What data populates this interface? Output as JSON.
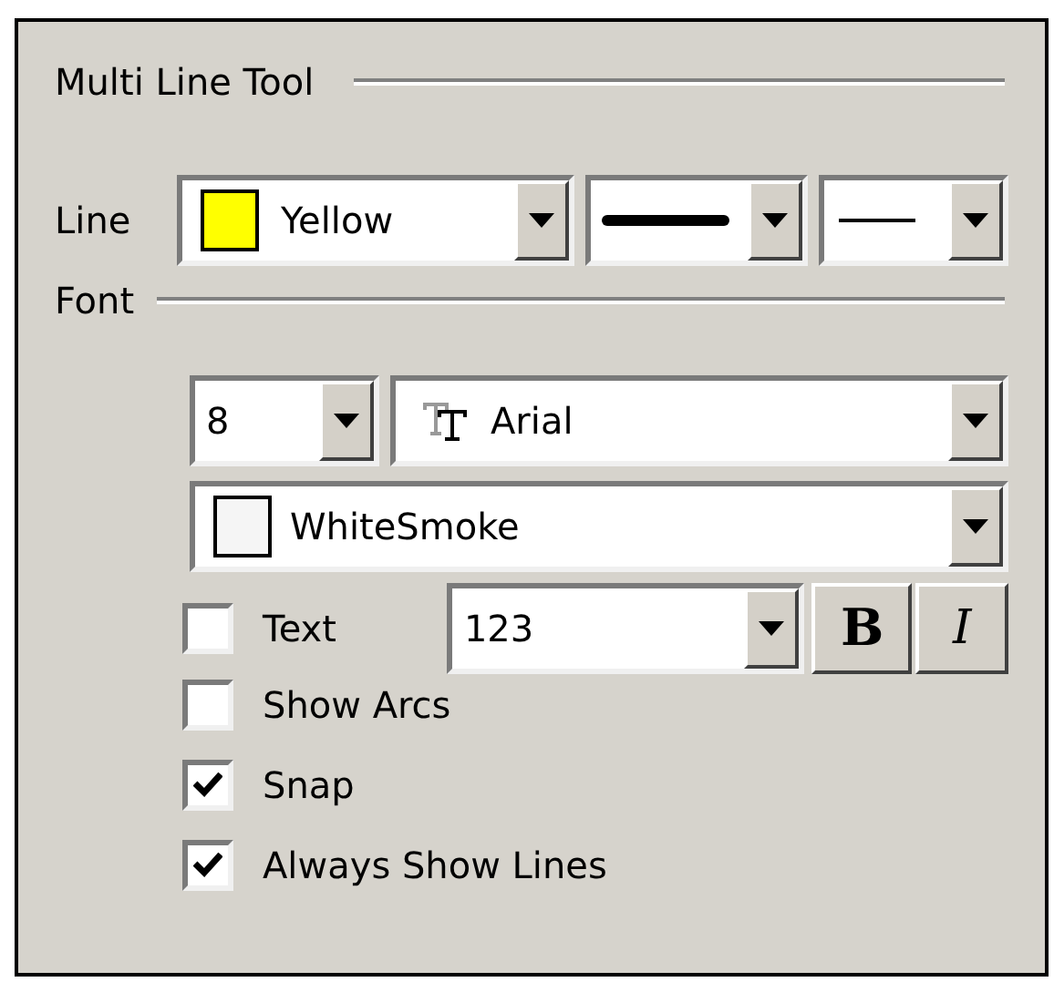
{
  "title": "Multi Line Tool",
  "line": {
    "label": "Line",
    "color": {
      "name": "Yellow",
      "color": "#ffff00"
    }
  },
  "font": {
    "label": "Font",
    "size": "8",
    "family": "Arial",
    "color": {
      "name": "WhiteSmoke",
      "color": "#f5f5f5"
    },
    "text_option": {
      "label": "Text",
      "checked": false,
      "value": "123"
    },
    "bold": "B",
    "italic": "I"
  },
  "options": [
    {
      "label": "Show Arcs",
      "checked": false
    },
    {
      "label": "Snap",
      "checked": true
    },
    {
      "label": "Always Show Lines",
      "checked": true
    }
  ]
}
